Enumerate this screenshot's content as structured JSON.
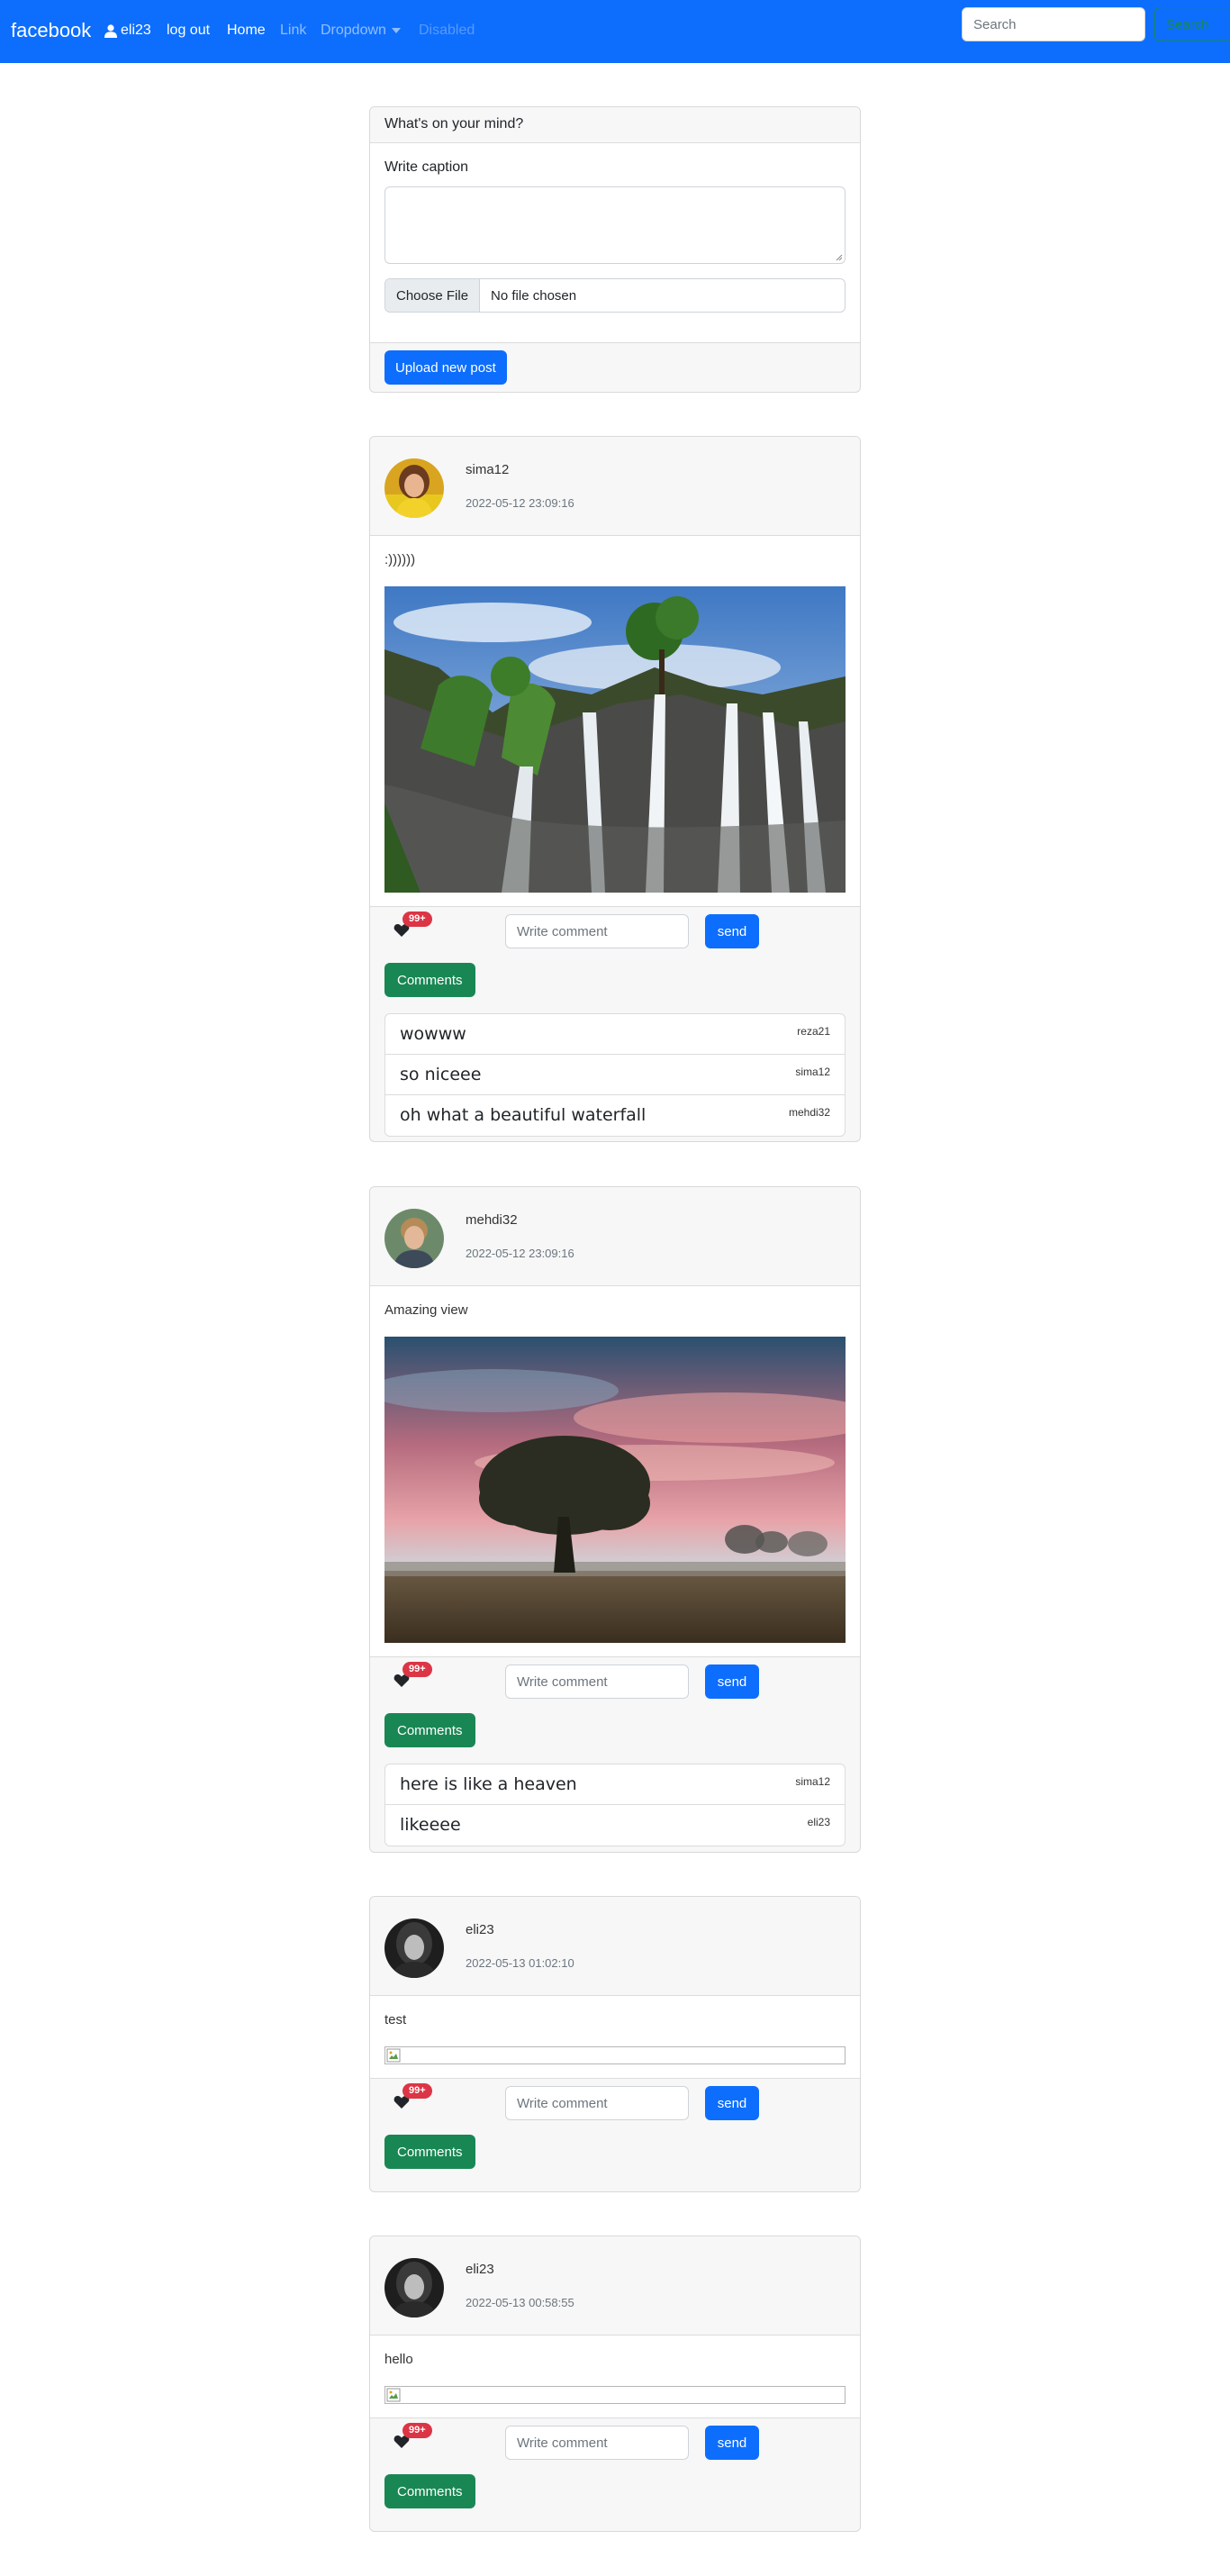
{
  "navbar": {
    "brand": "facebook",
    "user": "eli23",
    "logout": "log out",
    "home": "Home",
    "link": "Link",
    "dropdown": "Dropdown",
    "disabled": "Disabled",
    "search_placeholder": "Search",
    "search_button": "Search"
  },
  "composer": {
    "header": "What's on your mind?",
    "caption_label": "Write caption",
    "file_button": "Choose File",
    "file_status": "No file chosen",
    "upload_button": "Upload new post"
  },
  "common": {
    "like_badge": "99+",
    "comment_placeholder": "Write comment",
    "send_label": "send",
    "comments_label": "Comments"
  },
  "posts": [
    {
      "user": "sima12",
      "time": "2022-05-12 23:09:16",
      "caption": ":))))))",
      "image": "waterfall",
      "comments": [
        {
          "text": "wowww",
          "user": "reza21"
        },
        {
          "text": "so niceee",
          "user": "sima12"
        },
        {
          "text": "oh what a beautiful waterfall",
          "user": "mehdi32"
        }
      ]
    },
    {
      "user": "mehdi32",
      "time": "2022-05-12 23:09:16",
      "caption": "Amazing view",
      "image": "tree-sunset",
      "comments": [
        {
          "text": "here is like a heaven",
          "user": "sima12"
        },
        {
          "text": "likeeee",
          "user": "eli23"
        }
      ]
    },
    {
      "user": "eli23",
      "time": "2022-05-13 01:02:10",
      "caption": "test",
      "image": "broken",
      "comments": []
    },
    {
      "user": "eli23",
      "time": "2022-05-13 00:58:55",
      "caption": "hello",
      "image": "broken",
      "comments": []
    }
  ]
}
